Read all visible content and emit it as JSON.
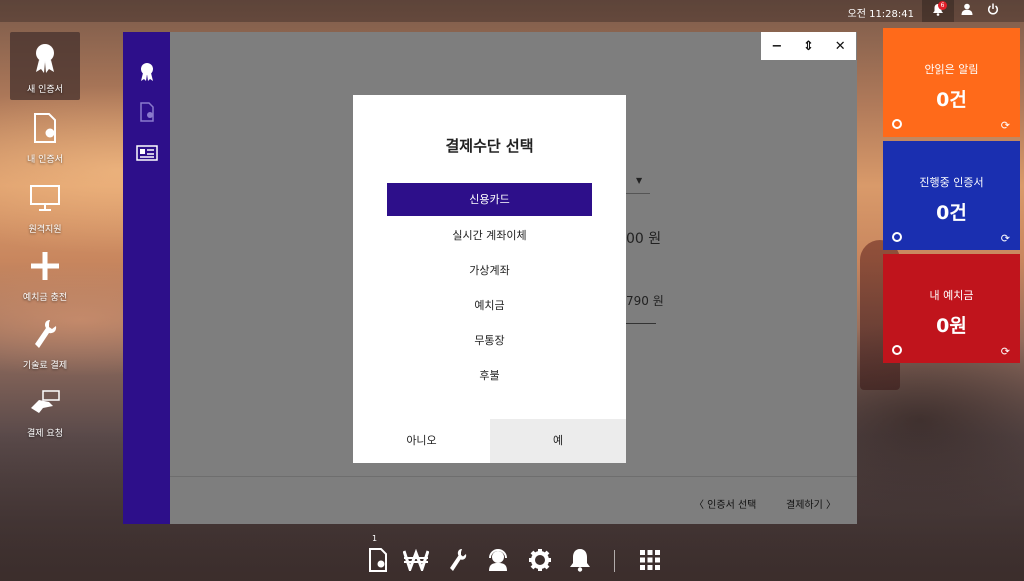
{
  "topbar": {
    "clock": "오전 11:28:41",
    "notif_count": "6"
  },
  "desktop": {
    "items": [
      {
        "label": "새 인증서",
        "icon": "ribbon-badge-icon"
      },
      {
        "label": "내 인증서",
        "icon": "certificate-doc-icon"
      },
      {
        "label": "원격지원",
        "icon": "monitor-icon"
      },
      {
        "label": "예치금 충전",
        "icon": "plus-icon"
      },
      {
        "label": "기술료 결제",
        "icon": "wrench-icon"
      },
      {
        "label": "결제 요청",
        "icon": "hand-card-icon"
      }
    ]
  },
  "window": {
    "bg_value_1": "00 원",
    "bg_value_2": "790 원",
    "footer": {
      "prev_label": "〈 인증서 선택",
      "next_label": "결제하기 〉"
    },
    "controls": {
      "minimize": "−",
      "restore": "⇕",
      "close": "✕"
    }
  },
  "dialog": {
    "title": "결제수단 선택",
    "options": [
      "신용카드",
      "실시간 계좌이체",
      "가상계좌",
      "예치금",
      "무통장",
      "후불"
    ],
    "selected_index": 0,
    "no_label": "아니오",
    "yes_label": "예"
  },
  "tiles": [
    {
      "label": "안읽은 알림",
      "value": "0건",
      "color": "#ff6a1a"
    },
    {
      "label": "진행중 인증서",
      "value": "0건",
      "color": "#1a2fb0"
    },
    {
      "label": "내 예치금",
      "value": "0원",
      "color": "#c0141c"
    }
  ],
  "dock": {
    "count": "1",
    "items": [
      "certificate-doc-icon",
      "won-icon",
      "wrench-icon",
      "support-headset-icon",
      "gear-icon",
      "bell-icon",
      "apps-grid-icon"
    ]
  }
}
